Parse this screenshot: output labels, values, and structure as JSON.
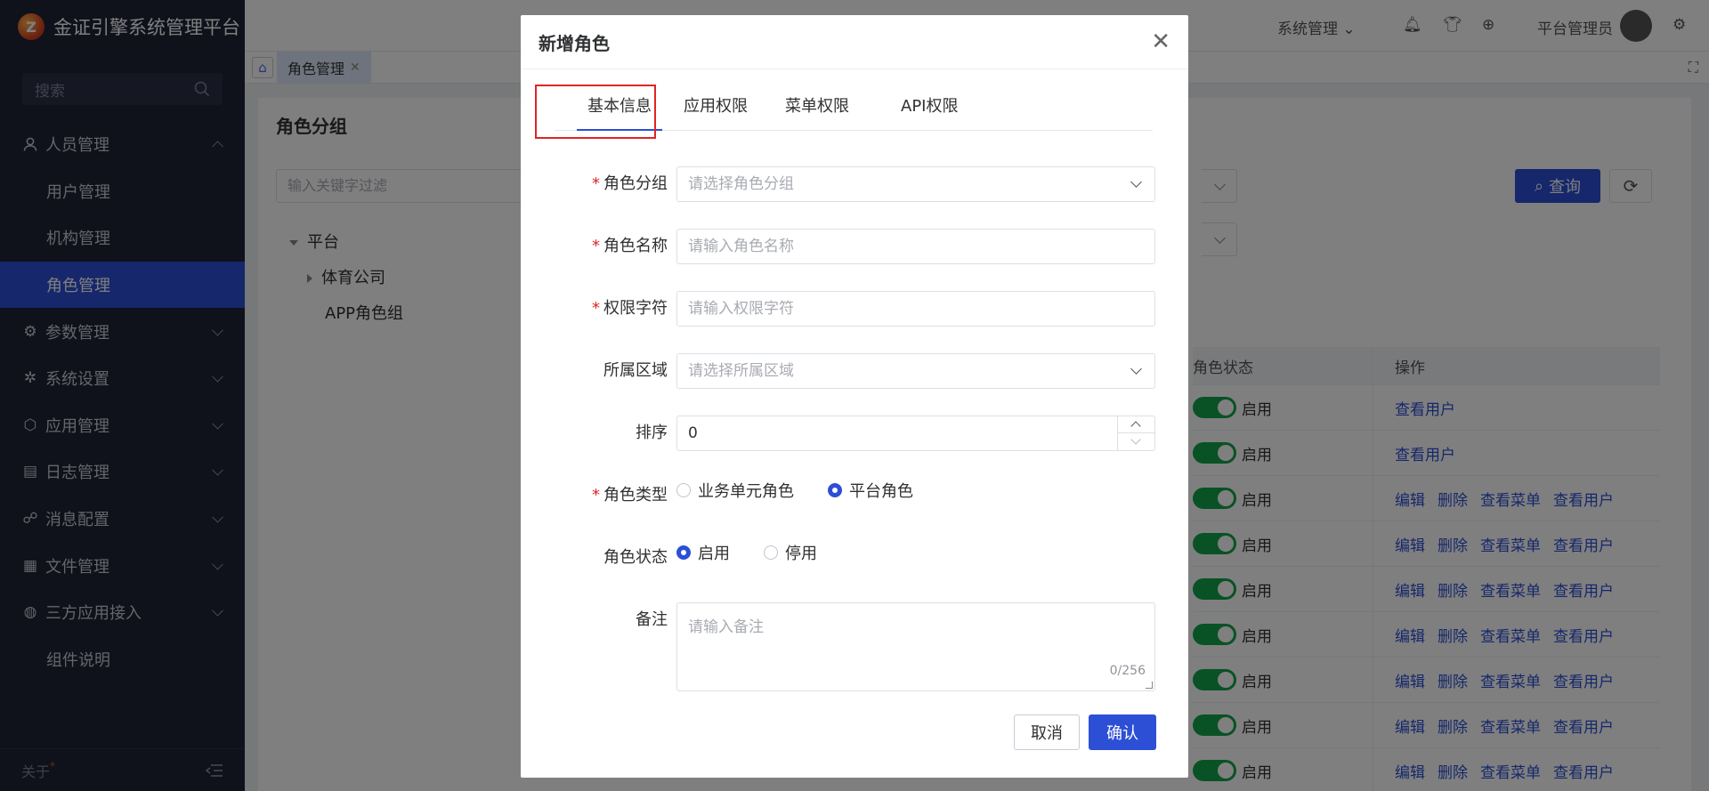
{
  "brand": {
    "title": "金证引擎系统管理平台"
  },
  "sidebar": {
    "search_placeholder": "搜索",
    "items": [
      {
        "label": "人员管理",
        "icon": "user-icon",
        "expanded": true
      },
      {
        "label": "用户管理",
        "sub": true
      },
      {
        "label": "机构管理",
        "sub": true
      },
      {
        "label": "角色管理",
        "sub": true,
        "active": true
      },
      {
        "label": "参数管理",
        "icon": "sliders-icon"
      },
      {
        "label": "系统设置",
        "icon": "gear-icon"
      },
      {
        "label": "应用管理",
        "icon": "cube-icon"
      },
      {
        "label": "日志管理",
        "icon": "document-icon"
      },
      {
        "label": "消息配置",
        "icon": "network-icon"
      },
      {
        "label": "文件管理",
        "icon": "file-icon"
      },
      {
        "label": "三方应用接入",
        "icon": "globe-icon"
      },
      {
        "label": "组件说明",
        "sub": true
      }
    ],
    "footer_label": "关于"
  },
  "header": {
    "system_menu": "系统管理",
    "user_name": "平台管理员"
  },
  "tabs": {
    "active_label": "角色管理"
  },
  "main": {
    "title": "角色分组",
    "filter_placeholder": "输入关键字过滤",
    "tree": {
      "root": "平台",
      "child1": "体育公司",
      "child2": "APP角色组"
    },
    "query_label": "查询",
    "table": {
      "col_status": "角色状态",
      "col_action": "操作",
      "rows": [
        {
          "status": "启用",
          "actions": [
            "查看用户"
          ]
        },
        {
          "status": "启用",
          "actions": [
            "查看用户"
          ]
        },
        {
          "status": "启用",
          "actions": [
            "编辑",
            "删除",
            "查看菜单",
            "查看用户"
          ]
        },
        {
          "status": "启用",
          "actions": [
            "编辑",
            "删除",
            "查看菜单",
            "查看用户"
          ]
        },
        {
          "status": "启用",
          "actions": [
            "编辑",
            "删除",
            "查看菜单",
            "查看用户"
          ]
        },
        {
          "status": "启用",
          "actions": [
            "编辑",
            "删除",
            "查看菜单",
            "查看用户"
          ]
        },
        {
          "status": "启用",
          "actions": [
            "编辑",
            "删除",
            "查看菜单",
            "查看用户"
          ]
        },
        {
          "status": "启用",
          "actions": [
            "编辑",
            "删除",
            "查看菜单",
            "查看用户"
          ]
        },
        {
          "status": "启用",
          "actions": [
            "编辑",
            "删除",
            "查看菜单",
            "查看用户"
          ]
        }
      ]
    }
  },
  "dialog": {
    "title": "新增角色",
    "tabs": [
      "基本信息",
      "应用权限",
      "菜单权限",
      "API权限"
    ],
    "active_tab": "基本信息",
    "fields": {
      "group_label": "角色分组",
      "group_placeholder": "请选择角色分组",
      "name_label": "角色名称",
      "name_placeholder": "请输入角色名称",
      "perm_label": "权限字符",
      "perm_placeholder": "请输入权限字符",
      "region_label": "所属区域",
      "region_placeholder": "请选择所属区域",
      "sort_label": "排序",
      "sort_value": "0",
      "type_label": "角色类型",
      "type_opt1": "业务单元角色",
      "type_opt2": "平台角色",
      "type_selected": "平台角色",
      "status_label": "角色状态",
      "status_opt1": "启用",
      "status_opt2": "停用",
      "status_selected": "启用",
      "remark_label": "备注",
      "remark_placeholder": "请输入备注",
      "remark_count": "0/256"
    },
    "cancel_label": "取消",
    "ok_label": "确认"
  },
  "colors": {
    "primary": "#2d4fd6",
    "sidebar_bg": "#1f2336",
    "switch_on": "#13a54b",
    "required": "#e02424"
  }
}
